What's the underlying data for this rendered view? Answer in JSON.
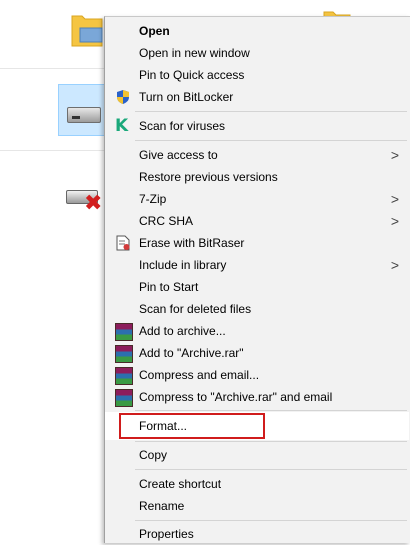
{
  "explorer": {
    "folder_label_left": "",
    "folder_label_right": ""
  },
  "menu": {
    "items": [
      {
        "label": "Open"
      },
      {
        "label": "Open in new window"
      },
      {
        "label": "Pin to Quick access"
      },
      {
        "label": "Turn on BitLocker"
      },
      {
        "label": "Scan for viruses"
      },
      {
        "label": "Give access to"
      },
      {
        "label": "Restore previous versions"
      },
      {
        "label": "7-Zip"
      },
      {
        "label": "CRC SHA"
      },
      {
        "label": "Erase with BitRaser"
      },
      {
        "label": "Include in library"
      },
      {
        "label": "Pin to Start"
      },
      {
        "label": "Scan for deleted files"
      },
      {
        "label": "Add to archive..."
      },
      {
        "label": "Add to \"Archive.rar\""
      },
      {
        "label": "Compress and email..."
      },
      {
        "label": "Compress to \"Archive.rar\" and email"
      },
      {
        "label": "Format..."
      },
      {
        "label": "Copy"
      },
      {
        "label": "Create shortcut"
      },
      {
        "label": "Rename"
      },
      {
        "label": "Properties"
      }
    ],
    "submenu_arrow": ">",
    "highlight_color": "#d01c1c",
    "kaspersky_color": "#1aa87a"
  }
}
